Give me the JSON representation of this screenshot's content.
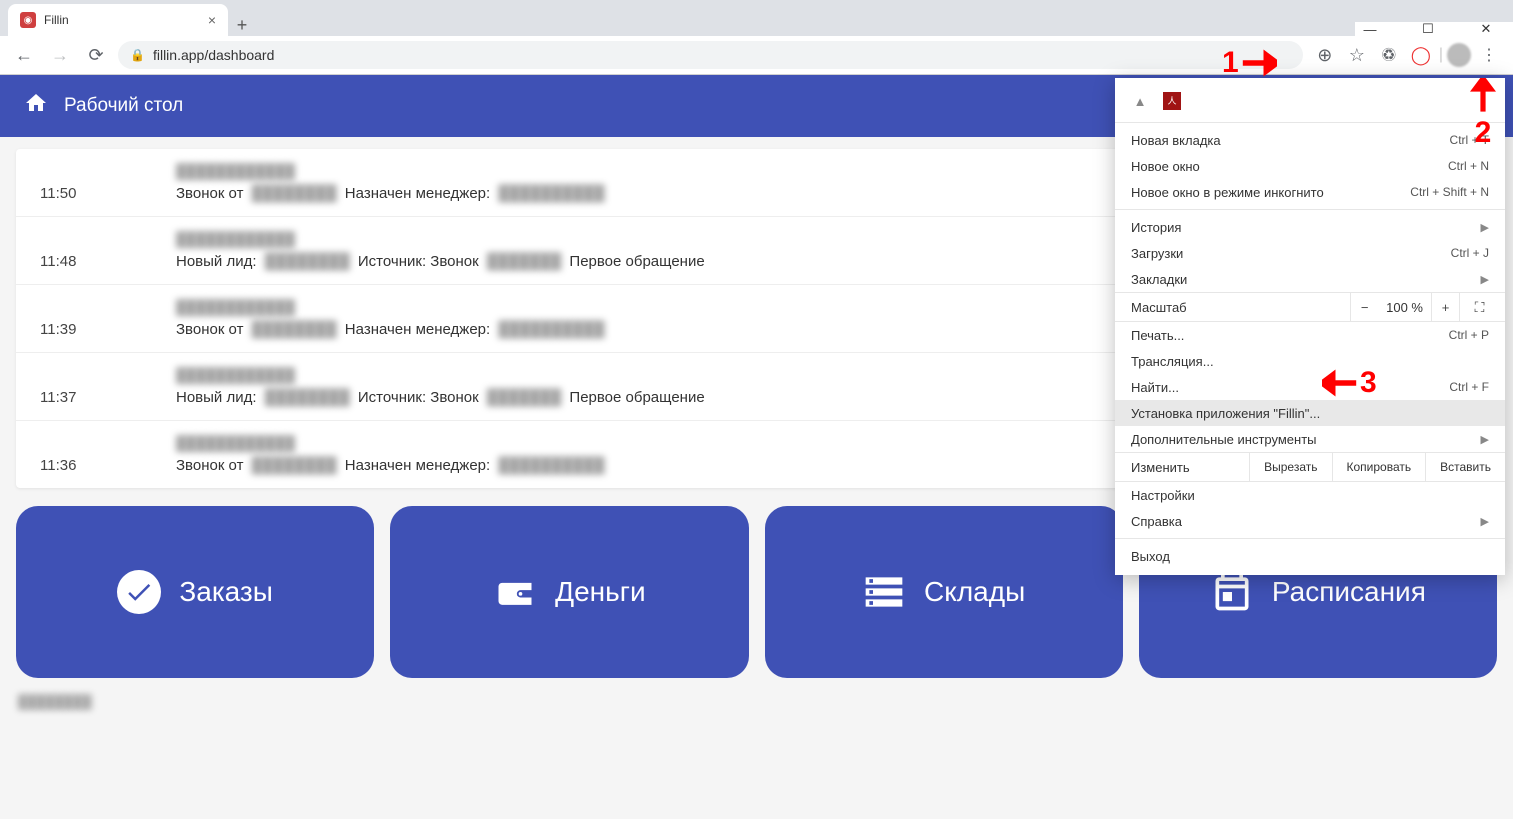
{
  "tab": {
    "title": "Fillin"
  },
  "url": "fillin.app/dashboard",
  "appHeader": "Рабочий стол",
  "feed": [
    {
      "time": "11:50",
      "meta": "████████████",
      "text_prefix": "Звонок от ",
      "blur1": "████████",
      "mid": " Назначен менеджер: ",
      "blur2": "██████████"
    },
    {
      "time": "11:48",
      "meta": "████████████",
      "text_prefix": "Новый лид: ",
      "blur1": "████████",
      "mid": " Источник: Звонок ",
      "blur2": "███████",
      "suffix": " Первое обращение"
    },
    {
      "time": "11:39",
      "meta": "████████████",
      "text_prefix": "Звонок от ",
      "blur1": "████████",
      "mid": " Назначен менеджер: ",
      "blur2": "██████████"
    },
    {
      "time": "11:37",
      "meta": "████████████",
      "text_prefix": "Новый лид: ",
      "blur1": "████████",
      "mid": " Источник: Звонок ",
      "blur2": "███████",
      "suffix": " Первое обращение"
    },
    {
      "time": "11:36",
      "meta": "████████████",
      "text_prefix": "Звонок от ",
      "blur1": "████████",
      "mid": " Назначен менеджер: ",
      "blur2": "██████████"
    }
  ],
  "tiles": {
    "orders": "Заказы",
    "money": "Деньги",
    "stores": "Склады",
    "schedules": "Расписания"
  },
  "menu": {
    "new_tab": "Новая вкладка",
    "new_tab_sc": "Ctrl + T",
    "new_window": "Новое окно",
    "new_window_sc": "Ctrl + N",
    "incognito": "Новое окно в режиме инкогнито",
    "incognito_sc": "Ctrl + Shift + N",
    "history": "История",
    "downloads": "Загрузки",
    "downloads_sc": "Ctrl + J",
    "bookmarks": "Закладки",
    "zoom_label": "Масштаб",
    "zoom_value": "100 %",
    "print": "Печать...",
    "print_sc": "Ctrl + P",
    "cast": "Трансляция...",
    "find": "Найти...",
    "find_sc": "Ctrl + F",
    "install": "Установка приложения \"Fillin\"...",
    "more_tools": "Дополнительные инструменты",
    "edit_label": "Изменить",
    "cut": "Вырезать",
    "copy": "Копировать",
    "paste": "Вставить",
    "settings": "Настройки",
    "help": "Справка",
    "exit": "Выход"
  },
  "annotations": {
    "a1": "1",
    "a2": "2",
    "a3": "3"
  }
}
